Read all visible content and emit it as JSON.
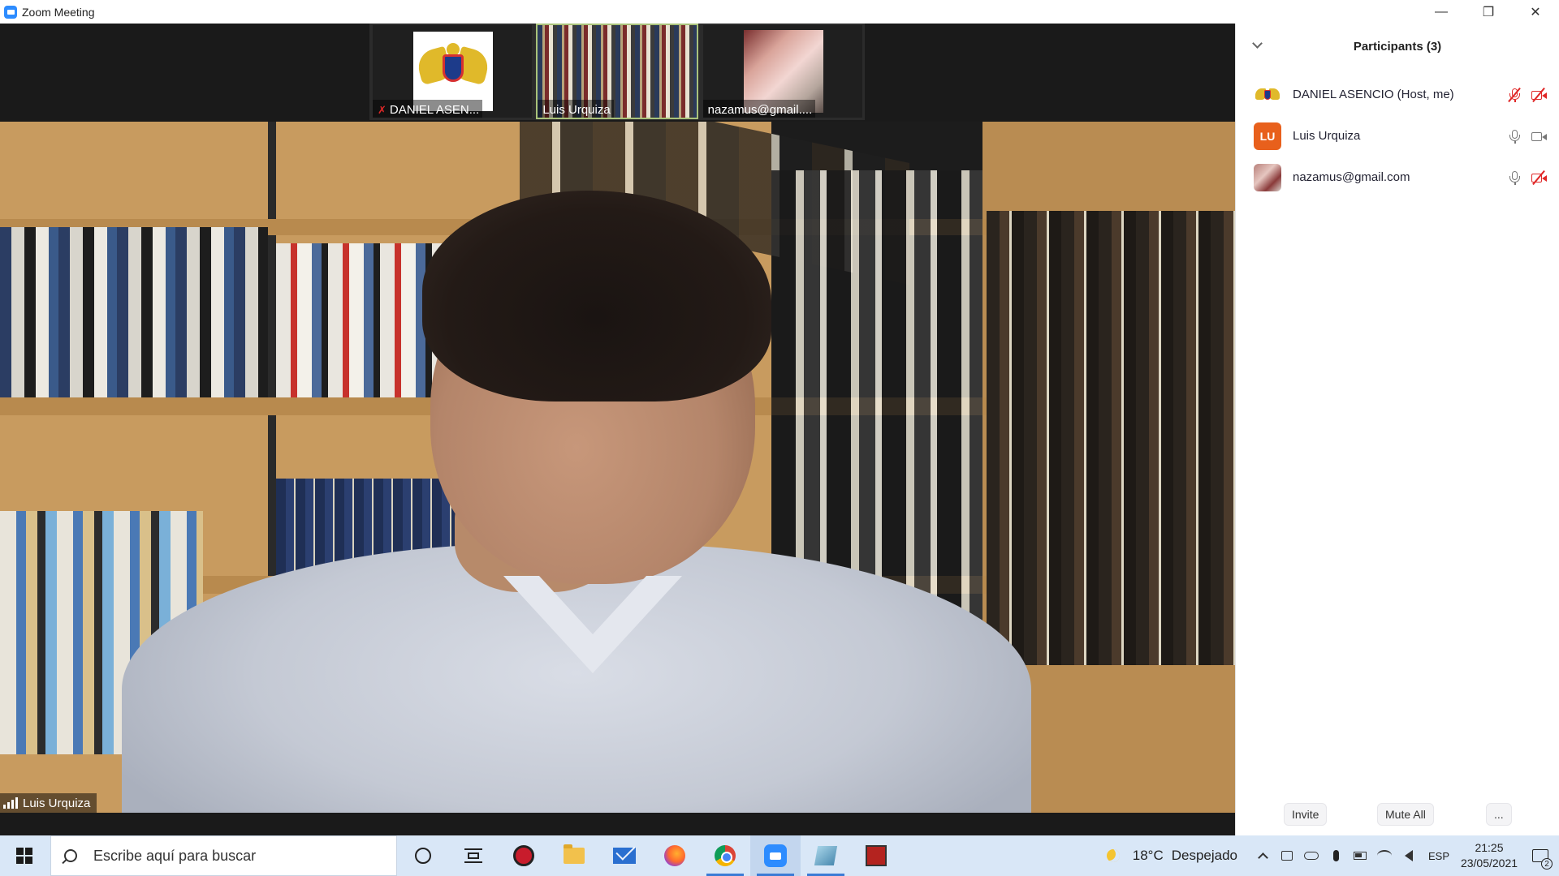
{
  "window": {
    "title": "Zoom Meeting",
    "controls": {
      "minimize": "—",
      "restore": "❐",
      "close": "✕"
    }
  },
  "thumbnails": [
    {
      "name": "DANIEL ASEN...",
      "muted": true,
      "kind": "logo"
    },
    {
      "name": "Luis Urquiza",
      "muted": false,
      "kind": "video",
      "active": true
    },
    {
      "name": "nazamus@gmail....",
      "muted": false,
      "kind": "photo"
    }
  ],
  "main_video": {
    "speaker_name": "Luis Urquiza",
    "signal_icon": "signal-bars-icon"
  },
  "participants_panel": {
    "title": "Participants (3)",
    "participants": [
      {
        "name": "DANIEL ASENCIO (Host, me)",
        "avatar": "logo",
        "mic": "muted",
        "video": "off"
      },
      {
        "name": "Luis Urquiza",
        "avatar_initials": "LU",
        "avatar": "initials",
        "mic": "on",
        "video": "on"
      },
      {
        "name": "nazamus@gmail.com",
        "avatar": "photo",
        "mic": "on",
        "video": "off"
      }
    ],
    "footer": {
      "invite": "Invite",
      "mute_all": "Mute All",
      "more": "..."
    }
  },
  "taskbar": {
    "search_placeholder": "Escribe aquí para buscar",
    "pinned_apps": [
      "cortana-icon",
      "task-view-icon",
      "gaming-app-icon",
      "file-explorer-icon",
      "mail-icon",
      "firefox-icon",
      "chrome-icon",
      "zoom-icon",
      "paper-app-icon",
      "dota-icon"
    ],
    "weather": {
      "temp": "18°C",
      "condition": "Despejado"
    },
    "language": "ESP",
    "time": "21:25",
    "date": "23/05/2021",
    "notification_count": "2"
  },
  "colors": {
    "zoom_blue": "#2d8cff",
    "muted_red": "#e02828",
    "lu_avatar": "#e8601c",
    "active_thumb_border": "#a9c27a",
    "taskbar_bg": "#d9e7f7"
  }
}
